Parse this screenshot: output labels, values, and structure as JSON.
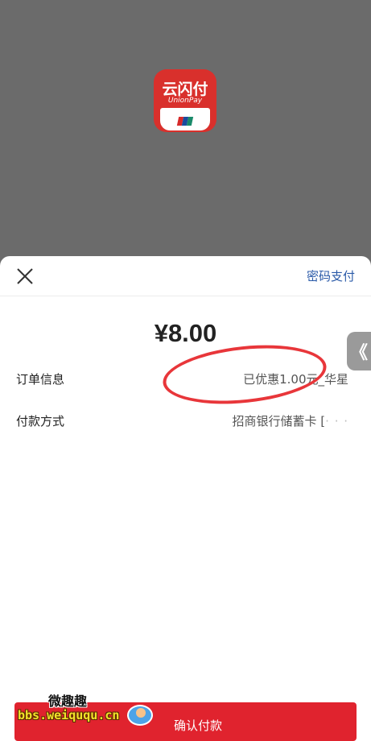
{
  "app_icon": {
    "brand": "云闪付",
    "sub": "UnionPay",
    "flag_colors": [
      "#d72a2a",
      "#1a4c9e",
      "#1a8a6a"
    ]
  },
  "header": {
    "close_icon": "close-icon",
    "password_pay_label": "密码支付"
  },
  "amount": "¥8.00",
  "order_info": {
    "label": "订单信息",
    "value": "已优惠1.00元_华星"
  },
  "payment_method": {
    "label": "付款方式",
    "value": "招商银行储蓄卡 [",
    "masked": "· · ·"
  },
  "side_tab": {
    "icon": "chevron-left-icon",
    "glyph": "《"
  },
  "confirm_label": "确认付款",
  "watermark": {
    "title": "微趣趣",
    "url": "bbs.weiququ.cn"
  },
  "colors": {
    "accent_blue": "#2a5aa8",
    "confirm_red": "#e0232e",
    "annotation_red": "#e8363a",
    "backdrop": "#6b6b6b"
  }
}
